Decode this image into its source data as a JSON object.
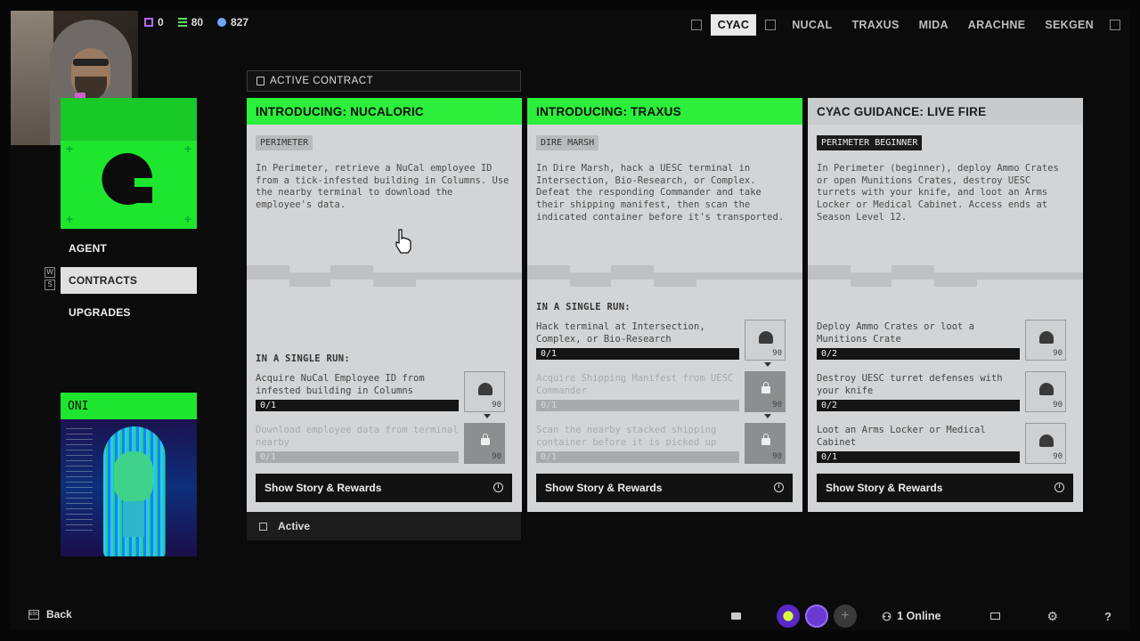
{
  "currencies": [
    {
      "icon": "purple-square-icon",
      "value": "0"
    },
    {
      "icon": "green-stack-icon",
      "value": "80"
    },
    {
      "icon": "blue-coin-icon",
      "value": "827"
    }
  ],
  "factions": {
    "active": "CYAC",
    "items": [
      "CYAC",
      "NUCAL",
      "TRAXUS",
      "MIDA",
      "ARACHNE",
      "SEKGEN"
    ]
  },
  "left_nav": {
    "items": [
      "AGENT",
      "CONTRACTS",
      "UPGRADES"
    ],
    "selected": "CONTRACTS",
    "key_hints": [
      "W",
      "S"
    ]
  },
  "agent": {
    "name": "ONI"
  },
  "active_contract_label": "ACTIVE CONTRACT",
  "cards": [
    {
      "title": "INTRODUCING: NUCALORIC",
      "location": "PERIMETER",
      "description": "In Perimeter, retrieve a NuCal employee ID from a tick-infested building in Columns. Use the nearby terminal to download the employee's data.",
      "run_label": "IN A SINGLE RUN:",
      "objectives": [
        {
          "text": "Acquire NuCal Employee ID from infested building in Columns",
          "progress": "0/1",
          "reward": "90",
          "locked": false
        },
        {
          "text": "Download employee data from terminal nearby",
          "progress": "0/1",
          "reward": "90",
          "locked": true
        }
      ],
      "button": "Show Story & Rewards"
    },
    {
      "title": "INTRODUCING: TRAXUS",
      "location": "DIRE MARSH",
      "description": "In Dire Marsh, hack a UESC terminal in Intersection, Bio-Research, or Complex. Defeat the responding Commander and take their shipping manifest, then scan the indicated container before it's transported.",
      "run_label": "IN A SINGLE RUN:",
      "objectives": [
        {
          "text": "Hack terminal at Intersection, Complex, or Bio-Research",
          "progress": "0/1",
          "reward": "90",
          "locked": false
        },
        {
          "text": "Acquire Shipping Manifest from UESC Commander",
          "progress": "0/1",
          "reward": "90",
          "locked": true
        },
        {
          "text": "Scan the nearby stacked shipping container before it is picked up",
          "progress": "0/1",
          "reward": "90",
          "locked": true
        }
      ],
      "button": "Show Story & Rewards"
    },
    {
      "title": "CYAC GUIDANCE: LIVE FIRE",
      "location": "PERIMETER BEGINNER",
      "description": "In Perimeter (beginner), deploy Ammo Crates or open Munitions Crates, destroy UESC turrets with your knife, and loot an Arms Locker or Medical Cabinet. Access ends at Season Level 12.",
      "objectives": [
        {
          "text": "Deploy Ammo Crates or loot a Munitions Crate",
          "progress": "0/2",
          "reward": "90",
          "locked": false
        },
        {
          "text": "Destroy UESC turret defenses with your knife",
          "progress": "0/2",
          "reward": "90",
          "locked": false
        },
        {
          "text": "Loot an Arms Locker or Medical Cabinet",
          "progress": "0/1",
          "reward": "90",
          "locked": false
        }
      ],
      "button": "Show Story & Rewards"
    }
  ],
  "active_status": "Active",
  "bottom": {
    "back_label": "Back",
    "online": "1 Online"
  }
}
